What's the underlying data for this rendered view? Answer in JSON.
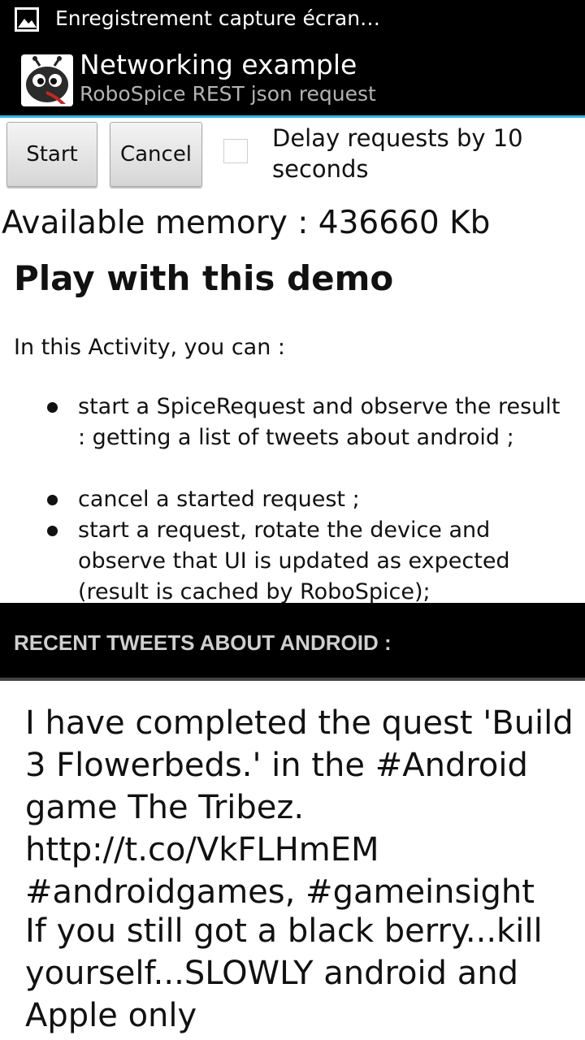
{
  "status_bar": {
    "notification_icon": "image-icon",
    "notification_text": "Enregistrement capture écran…"
  },
  "action_bar": {
    "app_icon": "robospice-logo-icon",
    "title": "Networking example",
    "subtitle": "RoboSpice REST json request",
    "accent_color": "#33b5e5"
  },
  "controls": {
    "start_label": "Start",
    "cancel_label": "Cancel",
    "delay_checked": false,
    "delay_label": "Delay requests by 10 seconds"
  },
  "memory_text": "Available memory : 436660 Kb",
  "demo": {
    "title": "Play with this demo",
    "intro": "In this Activity, you can :",
    "bullets": [
      "start a SpiceRequest and observe the result : getting a list of tweets about android ;",
      "cancel a started request ;",
      "start a request, rotate the device and observe that UI is updated as expected (result is cached by RoboSpice);"
    ]
  },
  "tweets_section": {
    "header": "RECENT TWEETS ABOUT ANDROID :",
    "tweets": [
      "I have completed the quest 'Build 3 Flowerbeds.' in the #Android game The Tribez. http://t.co/VkFLHmEM #androidgames, #gameinsight",
      "If you still got a black berry...kill yourself...SLOWLY android and Apple only"
    ]
  }
}
